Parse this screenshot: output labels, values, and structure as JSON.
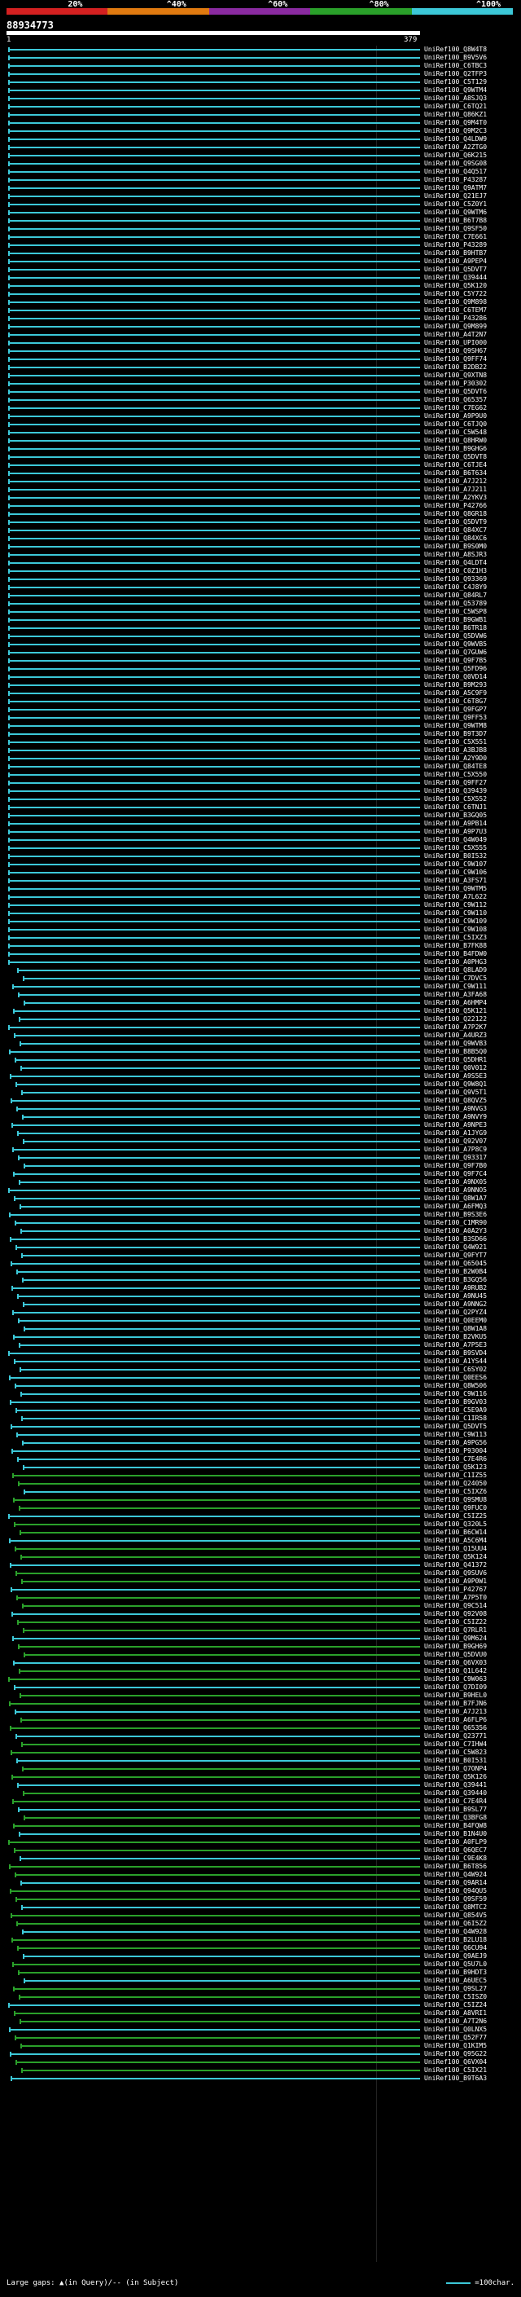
{
  "scale": {
    "ticks": [
      "20%",
      "^40%",
      "^60%",
      "^80%",
      "^100%"
    ],
    "colors": [
      "#d42020",
      "#e07a10",
      "#8a2aa0",
      "#2aa02a",
      "#3cc8d8"
    ]
  },
  "query": {
    "id": "88934773",
    "start": "1",
    "end": "379"
  },
  "hits": [
    "UniRef100_Q8W4T8",
    "UniRef100_B9V5V6",
    "UniRef100_C6TBC3",
    "UniRef100_Q2TFP3",
    "UniRef100_C5T129",
    "UniRef100_Q9WTM4",
    "UniRef100_A8SJQ3",
    "UniRef100_C6TQ21",
    "UniRef100_Q86KZ1",
    "UniRef100_Q9M4T0",
    "UniRef100_Q9M2C3",
    "UniRef100_Q4LDW9",
    "UniRef100_A2ZTG0",
    "UniRef100_Q6K215",
    "UniRef100_Q9SG08",
    "UniRef100_Q4Q517",
    "UniRef100_P43287",
    "UniRef100_Q9ATM7",
    "UniRef100_Q21EJ7",
    "UniRef100_C5Z0Y1",
    "UniRef100_Q9WTM6",
    "UniRef100_B6T7B8",
    "UniRef100_Q9SF50",
    "UniRef100_C7E661",
    "UniRef100_P43289",
    "UniRef100_B9HTB7",
    "UniRef100_A9PEP4",
    "UniRef100_Q5DVT7",
    "UniRef100_Q39444",
    "UniRef100_Q5K120",
    "UniRef100_C5Y722",
    "UniRef100_Q9M898",
    "UniRef100_C6TEM7",
    "UniRef100_P43286",
    "UniRef100_Q9M899",
    "UniRef100_A4T2N7",
    "UniRef100_UPI000",
    "UniRef100_Q9SH67",
    "UniRef100_Q9FF74",
    "UniRef100_B2DB22",
    "UniRef100_Q9XTN8",
    "UniRef100_P30302",
    "UniRef100_Q5DVT6",
    "UniRef100_Q65357",
    "UniRef100_C7EG62",
    "UniRef100_A9P9U0",
    "UniRef100_C6TJQ0",
    "UniRef100_C5W548",
    "UniRef100_Q8HRW0",
    "UniRef100_B9GHG6",
    "UniRef100_Q5DVT8",
    "UniRef100_C6TJE4",
    "UniRef100_B6T634",
    "UniRef100_A7J212",
    "UniRef100_A7J211",
    "UniRef100_A2YKV3",
    "UniRef100_P42766",
    "UniRef100_Q8GR18",
    "UniRef100_Q5DVT9",
    "UniRef100_Q84XC7",
    "UniRef100_Q84XC6",
    "UniRef100_B9S0M0",
    "UniRef100_A8SJR3",
    "UniRef100_Q4LDT4",
    "UniRef100_C0Z1H3",
    "UniRef100_Q93369",
    "UniRef100_C4J8Y9",
    "UniRef100_Q84RL7",
    "UniRef100_Q53789",
    "UniRef100_C5WSP8",
    "UniRef100_B9GWB1",
    "UniRef100_B6TR18",
    "UniRef100_Q5DVW6",
    "UniRef100_Q9WVB5",
    "UniRef100_Q7GUW6",
    "UniRef100_Q9F7B5",
    "UniRef100_Q5FD96",
    "UniRef100_Q0VD14",
    "UniRef100_B9M293",
    "UniRef100_A5C9F9",
    "UniRef100_C6T8G7",
    "UniRef100_Q9FGP7",
    "UniRef100_Q9FF53",
    "UniRef100_Q9WTM8",
    "UniRef100_B9T3D7",
    "UniRef100_C5X551",
    "UniRef100_A3BJB8",
    "UniRef100_A2Y9D0",
    "UniRef100_Q84TE8",
    "UniRef100_C5X550",
    "UniRef100_Q9FF27",
    "UniRef100_Q39439",
    "UniRef100_C5X552",
    "UniRef100_C6TNJ1",
    "UniRef100_B3GQ05",
    "UniRef100_A9PB14",
    "UniRef100_A9P7U3",
    "UniRef100_Q4W049",
    "UniRef100_C5X555",
    "UniRef100_B0I532",
    "UniRef100_C9W107",
    "UniRef100_C9W106",
    "UniRef100_A3FS71",
    "UniRef100_Q9WTM5",
    "UniRef100_A7L622",
    "UniRef100_C9W112",
    "UniRef100_C9W110",
    "UniRef100_C9W109",
    "UniRef100_C9W108",
    "UniRef100_C5IXZ3",
    "UniRef100_B7FK88",
    "UniRef100_B4FDW0",
    "UniRef100_A0PHG3",
    "UniRef100_Q8LAD9",
    "UniRef100_C7DVC5",
    "UniRef100_C9W111",
    "UniRef100_A3FA68",
    "UniRef100_A6HMP4",
    "UniRef100_Q5K121",
    "UniRef100_Q22122",
    "UniRef100_A7P2K7",
    "UniRef100_A4URZ3",
    "UniRef100_Q9WVB3",
    "UniRef100_B8B5Q0",
    "UniRef100_Q5DHR1",
    "UniRef100_Q0V012",
    "UniRef100_A9S5E3",
    "UniRef100_Q9W8Q1",
    "UniRef100_Q9V5T1",
    "UniRef100_Q8QVZ5",
    "UniRef100_A9NVG3",
    "UniRef100_A9NVY9",
    "UniRef100_A9NPE3",
    "UniRef100_A1JYG9",
    "UniRef100_Q92V07",
    "UniRef100_A7P8C9",
    "UniRef100_Q93317",
    "UniRef100_Q9F7B0",
    "UniRef100_Q9F7C4",
    "UniRef100_A9NX05",
    "UniRef100_A9NNO5",
    "UniRef100_Q8W1A7",
    "UniRef100_A6FMQ3",
    "UniRef100_B9S3E6",
    "UniRef100_C1MR90",
    "UniRef100_A0A2Y3",
    "UniRef100_B3SD66",
    "UniRef100_Q4W921",
    "UniRef100_Q9FYT7",
    "UniRef100_Q65045",
    "UniRef100_B2W0B4",
    "UniRef100_B3GQ56",
    "UniRef100_A9RUB2",
    "UniRef100_A9NU45",
    "UniRef100_A9NNG2",
    "UniRef100_Q2PYZ4",
    "UniRef100_Q0EEM0",
    "UniRef100_Q8W1A8",
    "UniRef100_B2VKU5",
    "UniRef100_A7P5E3",
    "UniRef100_B9SVD4",
    "UniRef100_A1YS44",
    "UniRef100_C6SY02",
    "UniRef100_Q0EES6",
    "UniRef100_Q8W506",
    "UniRef100_C9W116",
    "UniRef100_B9GV03",
    "UniRef100_C5E9A9",
    "UniRef100_C1IR58",
    "UniRef100_Q5DVT5",
    "UniRef100_C9W113",
    "UniRef100_A9PG56",
    "UniRef100_P93004",
    "UniRef100_C7E4R6",
    "UniRef100_Q5K123",
    "UniRef100_C1IZ55",
    "UniRef100_Q24050",
    "UniRef100_C5IXZ6",
    "UniRef100_Q9SMU8",
    "UniRef100_Q9FUC0",
    "UniRef100_C5IZ25",
    "UniRef100_Q320L5",
    "UniRef100_B6CW14",
    "UniRef100_A5C6M4",
    "UniRef100_Q15UU4",
    "UniRef100_Q5K124",
    "UniRef100_Q41372",
    "UniRef100_Q9SUV6",
    "UniRef100_A9P0W1",
    "UniRef100_P42767",
    "UniRef100_A7P5T0",
    "UniRef100_Q9C514",
    "UniRef100_Q92V08",
    "UniRef100_C5IZ22",
    "UniRef100_Q7RLR1",
    "UniRef100_Q9M624",
    "UniRef100_B9GH69",
    "UniRef100_Q5DVU0",
    "UniRef100_Q6VX03",
    "UniRef100_Q1L642",
    "UniRef100_C9W063",
    "UniRef100_Q7DI09",
    "UniRef100_B9HEL0",
    "UniRef100_B7FJN6",
    "UniRef100_A7J213",
    "UniRef100_A6FLP6",
    "UniRef100_Q65356",
    "UniRef100_Q23771",
    "UniRef100_C7IHW4",
    "UniRef100_C5W823",
    "UniRef100_B0I531",
    "UniRef100_Q7ONP4",
    "UniRef100_Q5K126",
    "UniRef100_Q39441",
    "UniRef100_Q39440",
    "UniRef100_C7E4R4",
    "UniRef100_B9SL77",
    "UniRef100_Q3BFG8",
    "UniRef100_B4FQW8",
    "UniRef100_B1N4U0",
    "UniRef100_A0FLP9",
    "UniRef100_Q6QEC7",
    "UniRef100_C9E4K8",
    "UniRef100_B6T856",
    "UniRef100_Q4W924",
    "UniRef100_Q9AR14",
    "UniRef100_Q94QU5",
    "UniRef100_Q9SF59",
    "UniRef100_Q8MTC2",
    "UniRef100_Q854V5",
    "UniRef100_Q6I5Z2",
    "UniRef100_Q4W928",
    "UniRef100_B2LU18",
    "UniRef100_Q6CU94",
    "UniRef100_Q9AEJ9",
    "UniRef100_Q5U7L0",
    "UniRef100_B9HDT3",
    "UniRef100_A6UEC5",
    "UniRef100_Q9SL27",
    "UniRef100_C5ISZ0",
    "UniRef100_C5IZ24",
    "UniRef100_A8VRI1",
    "UniRef100_A7T2N6",
    "UniRef100_Q0LNX5",
    "UniRef100_Q52F77",
    "UniRef100_Q1KIM5",
    "UniRef100_Q95G22",
    "UniRef100_Q6VX04",
    "UniRef100_C5IX21",
    "UniRef100_B9T6A3"
  ]
}
